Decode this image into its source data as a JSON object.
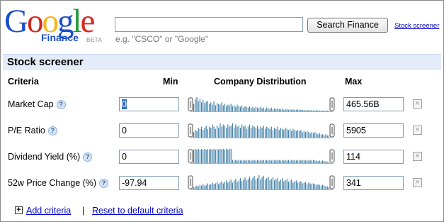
{
  "logo": {
    "letters": [
      "G",
      "o",
      "o",
      "g",
      "l",
      "e"
    ],
    "product": "Finance",
    "beta": "BETA",
    "colors": [
      "#1b4fc6",
      "#d3281c",
      "#f2b61b",
      "#1b4fc6",
      "#239a37",
      "#d3281c"
    ]
  },
  "search": {
    "value": "",
    "button_label": "Search Finance",
    "hint": "e.g. \"CSCO\" or \"Google\""
  },
  "header_link": "Stock screener",
  "panel_title": "Stock screener",
  "columns": {
    "criteria": "Criteria",
    "min": "Min",
    "distribution": "Company Distribution",
    "max": "Max"
  },
  "criteria": [
    {
      "label": "Market Cap",
      "min": "0",
      "max": "465.56B",
      "distribution": [
        10,
        16,
        19,
        14,
        17,
        12,
        15,
        11,
        13,
        14,
        10,
        12,
        9,
        13,
        8,
        11,
        10,
        9,
        12,
        8,
        10,
        7,
        9,
        8,
        10,
        7,
        8,
        6,
        9,
        7,
        6,
        8,
        5,
        7,
        6,
        5,
        7,
        5,
        6,
        4,
        6,
        5,
        4,
        6,
        4,
        5,
        3,
        5,
        4,
        3,
        5,
        3,
        4,
        3,
        4,
        3,
        3,
        4,
        2,
        3,
        3,
        2,
        3,
        2,
        3,
        2,
        2,
        3,
        2,
        2,
        2,
        2,
        1,
        2,
        2,
        1,
        2,
        1,
        1,
        2,
        1,
        1,
        1,
        1,
        1,
        1,
        1,
        1
      ]
    },
    {
      "label": "P/E Ratio",
      "min": "0",
      "max": "5905",
      "distribution": [
        5,
        7,
        6,
        9,
        8,
        10,
        7,
        9,
        11,
        8,
        10,
        9,
        12,
        10,
        8,
        11,
        9,
        13,
        10,
        12,
        11,
        9,
        12,
        10,
        11,
        13,
        9,
        12,
        10,
        11,
        9,
        12,
        10,
        11,
        8,
        10,
        12,
        9,
        11,
        10,
        9,
        11,
        8,
        10,
        9,
        11,
        8,
        10,
        9,
        8,
        10,
        7,
        9,
        8,
        10,
        7,
        9,
        8,
        7,
        9,
        8,
        7,
        8,
        6,
        8,
        7,
        6,
        7,
        6,
        7,
        5,
        6,
        5,
        6,
        5,
        4,
        5,
        4,
        5,
        4,
        3,
        4,
        3,
        3,
        2,
        3,
        2,
        2
      ]
    },
    {
      "label": "Dividend Yield (%)",
      "min": "0",
      "max": "114",
      "distribution": [
        21,
        22,
        21,
        22,
        21,
        22,
        21,
        22,
        21,
        22,
        21,
        22,
        21,
        22,
        21,
        22,
        21,
        22,
        21,
        22,
        21,
        22,
        21,
        22,
        22,
        5,
        4,
        5,
        4,
        5,
        4,
        5,
        4,
        5,
        4,
        5,
        4,
        5,
        4,
        5,
        4,
        5,
        4,
        5,
        4,
        5,
        4,
        5,
        4,
        5,
        4,
        5,
        4,
        5,
        4,
        5,
        4,
        5,
        4,
        5,
        4,
        5,
        4,
        5,
        4,
        5,
        4,
        5,
        4,
        5,
        4,
        5,
        4,
        5,
        4,
        5,
        4,
        5,
        4,
        4,
        3,
        4,
        3,
        4,
        3,
        3,
        2,
        2
      ]
    },
    {
      "label": "52w Price Change (%)",
      "min": "-97.94",
      "max": "341",
      "distribution": [
        3,
        4,
        5,
        4,
        6,
        5,
        7,
        5,
        6,
        8,
        6,
        7,
        9,
        7,
        8,
        10,
        7,
        9,
        11,
        8,
        10,
        12,
        9,
        11,
        13,
        9,
        12,
        14,
        10,
        12,
        15,
        11,
        13,
        16,
        12,
        14,
        17,
        12,
        15,
        18,
        13,
        15,
        19,
        13,
        16,
        18,
        13,
        15,
        17,
        12,
        14,
        16,
        12,
        14,
        15,
        11,
        13,
        15,
        11,
        12,
        14,
        10,
        12,
        13,
        9,
        11,
        12,
        9,
        10,
        11,
        8,
        9,
        10,
        7,
        9,
        8,
        7,
        8,
        7,
        6,
        7,
        6,
        5,
        6,
        5,
        4,
        4,
        3
      ]
    }
  ],
  "footer": {
    "add_criteria": "Add criteria",
    "separator": "|",
    "reset": "Reset to default criteria"
  }
}
